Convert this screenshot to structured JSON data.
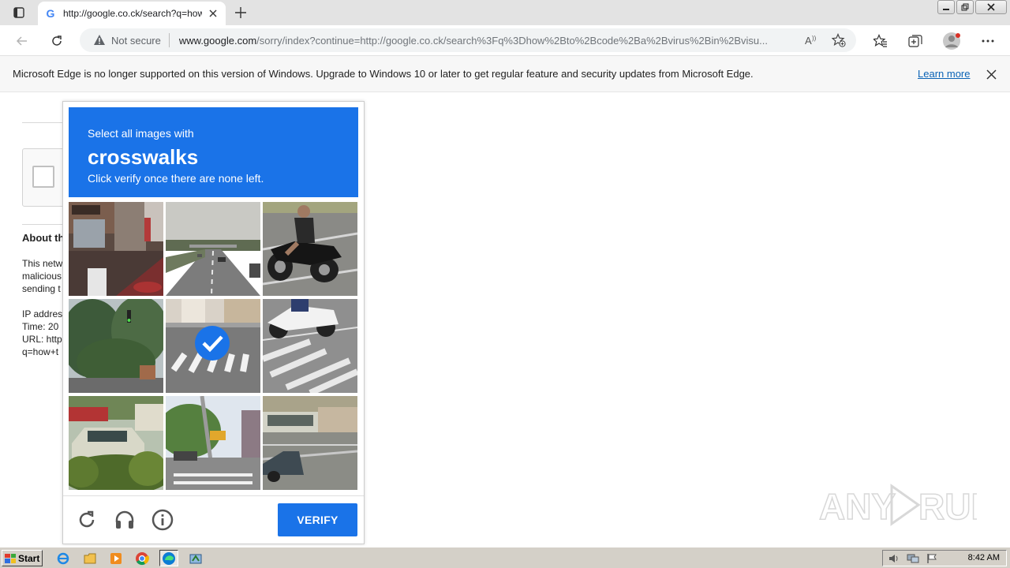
{
  "browser": {
    "tab": {
      "title": "http://google.co.ck/search?q=how+to+code+a+virus+in+visual+basic",
      "favicon_letter": "G"
    },
    "address": {
      "security_label": "Not secure",
      "url_host": "www.google.com",
      "url_path": "/sorry/index?continue=http://google.co.ck/search%3Fq%3Dhow%2Bto%2Bcode%2Ba%2Bvirus%2Bin%2Bvisu..."
    }
  },
  "infobar": {
    "message": "Microsoft Edge is no longer supported on this version of Windows. Upgrade to Windows 10 or later to get regular feature and security updates from Microsoft Edge.",
    "link_label": "Learn more"
  },
  "page": {
    "about_heading": "About th",
    "about_lines": [
      "This netw",
      "malicious",
      "sending t",
      "",
      "IP addres",
      "Time: 20",
      "URL: http",
      "q=how+t"
    ]
  },
  "captcha": {
    "instruction": "Select all images with",
    "keyword": "crosswalks",
    "hint": "Click verify once there are none left.",
    "verify_label": "VERIFY",
    "tiles": [
      {
        "name": "storefront",
        "selected": false
      },
      {
        "name": "highway",
        "selected": false
      },
      {
        "name": "motorcycle",
        "selected": false
      },
      {
        "name": "trees-traffic-light",
        "selected": false
      },
      {
        "name": "crosswalk",
        "selected": true
      },
      {
        "name": "scooter-crosswalk",
        "selected": false
      },
      {
        "name": "parked-car-bushes",
        "selected": false
      },
      {
        "name": "street-crosswalk",
        "selected": false
      },
      {
        "name": "street-bus",
        "selected": false
      }
    ]
  },
  "watermark": {
    "text": "ANY RUN"
  },
  "taskbar": {
    "start_label": "Start",
    "clock": "8:42 AM"
  },
  "colors": {
    "accent": "#1a73e8",
    "page": "#ffffff",
    "taskbar": "#d4d0c8"
  }
}
